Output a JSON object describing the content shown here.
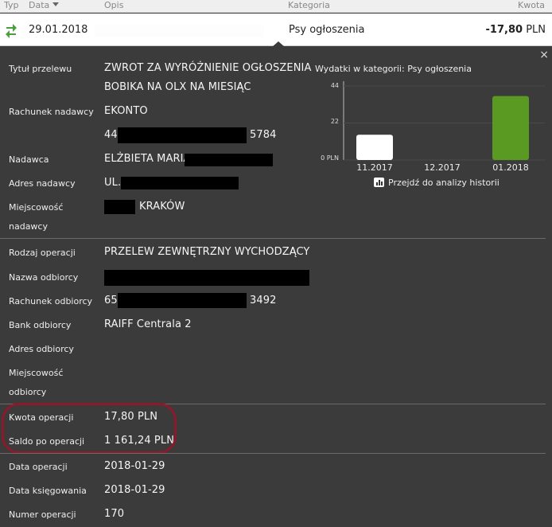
{
  "columns": {
    "typ": "Typ",
    "data": "Data",
    "opis": "Opis",
    "kategoria": "Kategoria",
    "kwota": "Kwota"
  },
  "transaction": {
    "date": "29.01.2018",
    "category": "Psy ogłoszenia",
    "amount": "-17,80",
    "currency": "PLN",
    "type_icon": "transfer-arrows-icon"
  },
  "close_label": "×",
  "details": {
    "tytul_label": "Tytuł przelewu",
    "tytul_line1": "ZWROT ZA WYRÓŻNIENIE OGŁOSZENIA",
    "tytul_line2": "BOBIKA NA OLX NA MIESIĄC",
    "rachunek_nadawcy_label": "Rachunek nadawcy",
    "rachunek_nadawcy_name": "EKONTO",
    "rachunek_nadawcy_prefix": "44",
    "rachunek_nadawcy_suffix": "5784",
    "nadawca_label": "Nadawca",
    "nadawca_value": "ELŻBIETA MARIA",
    "adres_nadawcy_label": "Adres nadawcy",
    "adres_nadawcy_value": "UL.",
    "miejscowosc_nadawcy_label1": "Miejscowość",
    "miejscowosc_nadawcy_label2": "nadawcy",
    "miejscowosc_nadawcy_value": "KRAKÓW",
    "rodzaj_label": "Rodzaj operacji",
    "rodzaj_value": "PRZELEW ZEWNĘTRZNY WYCHODZĄCY",
    "nazwa_odbiorcy_label": "Nazwa odbiorcy",
    "rachunek_odbiorcy_label": "Rachunek odbiorcy",
    "rachunek_odbiorcy_prefix": "65",
    "rachunek_odbiorcy_suffix": "3492",
    "bank_label": "Bank odbiorcy",
    "bank_value": "RAIFF Centrala 2",
    "adres_odbiorcy_label": "Adres odbiorcy",
    "miejscowosc_odbiorcy_label1": "Miejscowość",
    "miejscowosc_odbiorcy_label2": "odbiorcy",
    "kwota_label": "Kwota operacji",
    "kwota_value": "17,80 PLN",
    "saldo_label": "Saldo po operacji",
    "saldo_value": "1 161,24 PLN",
    "data_op_label": "Data operacji",
    "data_op_value": "2018-01-29",
    "data_ks_label": "Data księgowania",
    "data_ks_value": "2018-01-29",
    "numer_label": "Numer operacji",
    "numer_value": "170"
  },
  "chart_data": {
    "type": "bar",
    "title": "Wydatki w kategorii:  Psy ogłoszenia",
    "categories": [
      "11.2017",
      "12.2017",
      "01.2018"
    ],
    "values": [
      15,
      0,
      38
    ],
    "yticks": [
      "44",
      "22",
      "0 PLN"
    ],
    "ylim": [
      0,
      44
    ],
    "colors": [
      "#ffffff",
      "#ffffff",
      "#5a9a22"
    ]
  },
  "history_link": "Przejdź do analizy historii",
  "colors": {
    "background": "#3b3b3b",
    "accent_green": "#5a9a22",
    "highlight": "#8c1a2a"
  }
}
